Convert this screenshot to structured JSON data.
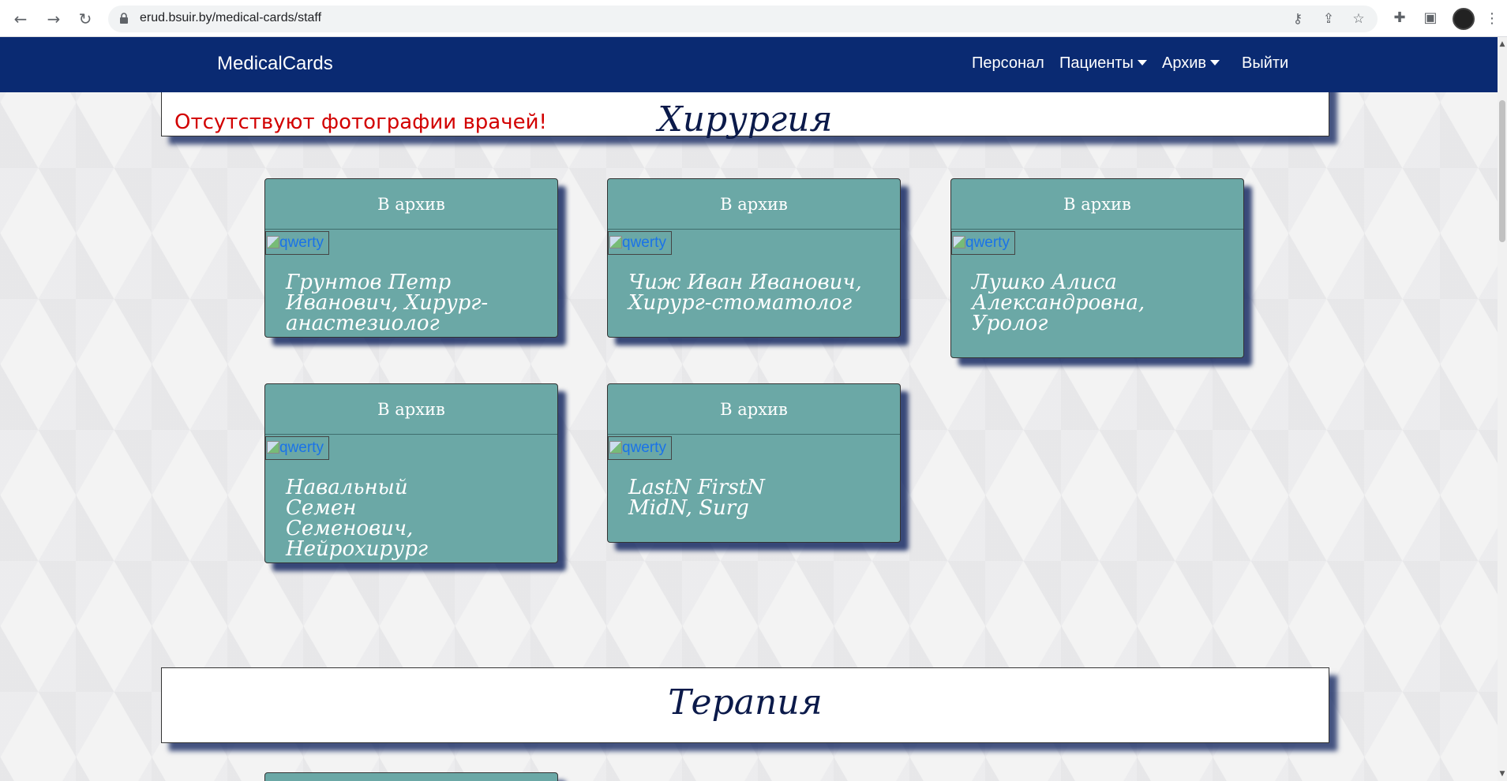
{
  "browser": {
    "url": "erud.bsuir.by/medical-cards/staff"
  },
  "navbar": {
    "brand": "MedicalCards",
    "links": {
      "staff": "Персонал",
      "patients": "Пациенты",
      "archive": "Архив",
      "logout": "Выйти"
    }
  },
  "sections": {
    "surgery": {
      "title": "Хирургия",
      "warning": "Отсутствуют фотографии врачей!",
      "cards": [
        {
          "action": "В архив",
          "img_alt": "qwerty",
          "name": "Грунтов Петр Иванович, Хирург-анастезиолог"
        },
        {
          "action": "В архив",
          "img_alt": "qwerty",
          "name": "Чиж Иван Иванович, Хирург-стоматолог"
        },
        {
          "action": "В архив",
          "img_alt": "qwerty",
          "name": "Лушко Алиса Александровна, Уролог"
        },
        {
          "action": "В архив",
          "img_alt": "qwerty",
          "name": "Навальный Семен Семенович, Нейрохирург"
        },
        {
          "action": "В архив",
          "img_alt": "qwerty",
          "name": "LastN FirstN MidN, Surg"
        }
      ]
    },
    "therapy": {
      "title": "Терапия"
    }
  },
  "colors": {
    "navbar": "#0a2a72",
    "card": "#6ba8a6",
    "warning": "#d20000",
    "title": "#0b1a4a"
  }
}
